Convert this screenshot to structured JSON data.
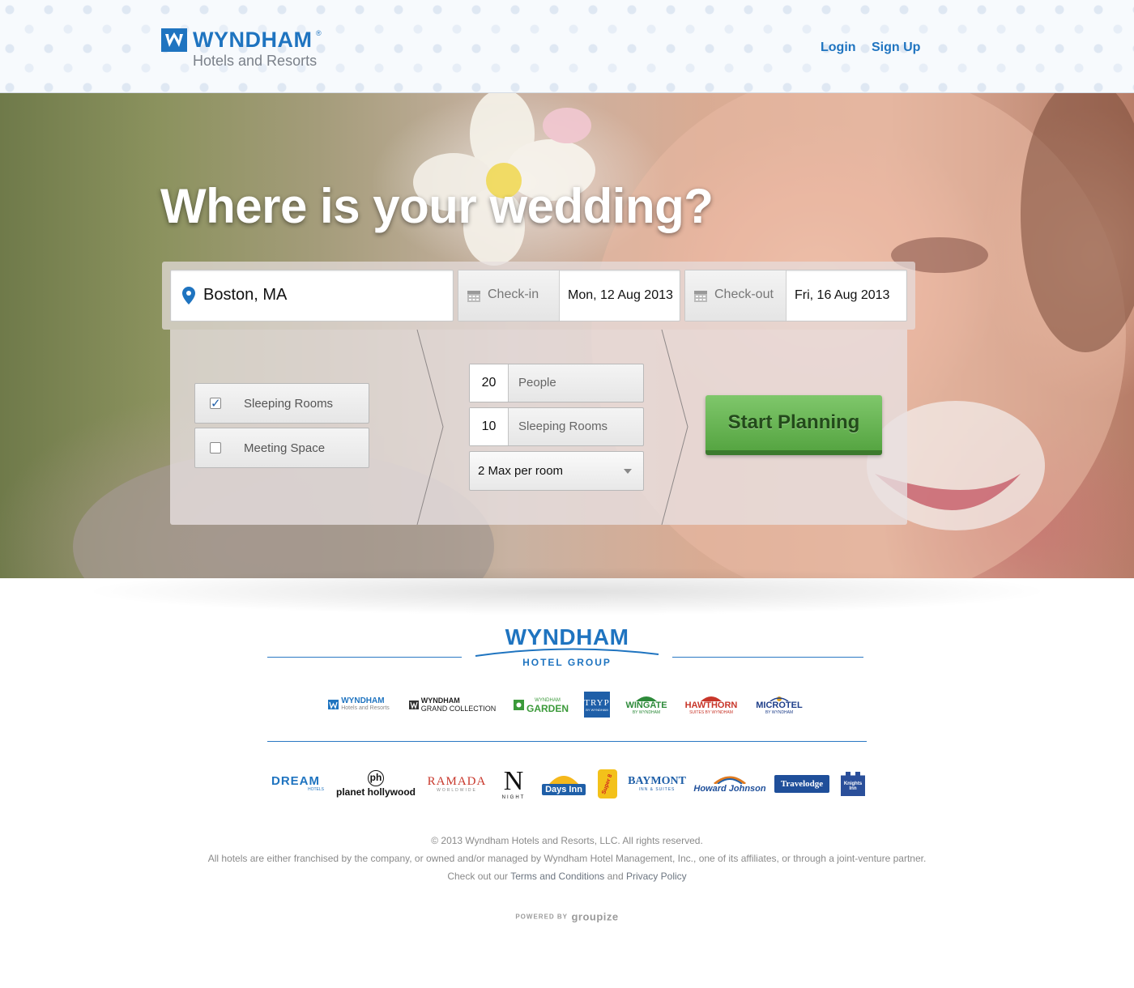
{
  "header": {
    "logo_name": "WYNDHAM",
    "logo_reg": "®",
    "logo_sub": "Hotels and Resorts",
    "login": "Login",
    "signup": "Sign Up"
  },
  "hero": {
    "headline": "Where is your wedding?",
    "location": "Boston, MA",
    "checkin_label": "Check-in",
    "checkin_value": "Mon, 12 Aug 2013",
    "checkout_label": "Check-out",
    "checkout_value": "Fri, 16 Aug 2013",
    "sleeping_rooms_label": "Sleeping Rooms",
    "sleeping_rooms_checked": true,
    "meeting_space_label": "Meeting Space",
    "meeting_space_checked": false,
    "people_count": "20",
    "people_label": "People",
    "rooms_count": "10",
    "rooms_label": "Sleeping Rooms",
    "max_per_room": "2 Max per room",
    "cta": "Start Planning"
  },
  "footer": {
    "group_name": "WYNDHAM",
    "group_sub": "HOTEL GROUP",
    "brands_row1": [
      {
        "line1": "WYNDHAM",
        "line2": "Hotels and Resorts",
        "color": "#1f74c0"
      },
      {
        "line1": "WYNDHAM",
        "line2": "GRAND COLLECTION",
        "color": "#222222"
      },
      {
        "line1": "WYNDHAM",
        "line2": "GARDEN",
        "color": "#3b9a3a"
      },
      {
        "line1": "TRYP",
        "line2": "BY WYNDHAM",
        "color": "#1f5fa8"
      },
      {
        "line1": "WINGATE",
        "line2": "BY WYNDHAM",
        "color": "#2d8a3a"
      },
      {
        "line1": "HAWTHORN",
        "line2": "SUITES BY WYNDHAM",
        "color": "#c8362a"
      },
      {
        "line1": "MICROTEL",
        "line2": "BY WYNDHAM",
        "color": "#1f3f8a"
      }
    ],
    "brands_row2": [
      {
        "line1": "DREAM",
        "line2": "HOTELS",
        "color": "#1f74c0"
      },
      {
        "line1": "planet hollywood",
        "line2": "ph",
        "color": "#111111"
      },
      {
        "line1": "RAMADA",
        "line2": "WORLDWIDE",
        "color": "#c8362a"
      },
      {
        "line1": "N",
        "line2": "NIGHT",
        "color": "#111111"
      },
      {
        "line1": "Days Inn",
        "line2": "",
        "color": "#1f5fa8"
      },
      {
        "line1": "Super 8",
        "line2": "",
        "color": "#d0261d"
      },
      {
        "line1": "BAYMONT",
        "line2": "INN & SUITES",
        "color": "#1f5fa8"
      },
      {
        "line1": "Howard Johnson",
        "line2": "",
        "color": "#1f4f9a"
      },
      {
        "line1": "Travelodge",
        "line2": "",
        "color": "#1f4f9a"
      },
      {
        "line1": "Knights",
        "line2": "Inn",
        "color": "#2a4f9a"
      }
    ],
    "copyright": "© 2013 Wyndham Hotels and Resorts, LLC. All rights reserved.",
    "franchise": "All hotels are either franchised by the company, or owned and/or managed by Wyndham Hotel Management, Inc., one of its affiliates, or through a joint-venture partner.",
    "terms_prefix": "Check out our",
    "terms_link": "Terms and Conditions",
    "terms_and": "and",
    "privacy_link": "Privacy Policy",
    "powered_by": "POWERED BY",
    "powered_brand": "groupize"
  },
  "colors": {
    "brand_blue": "#1f74c0",
    "cta_green": "#5fae4a"
  }
}
